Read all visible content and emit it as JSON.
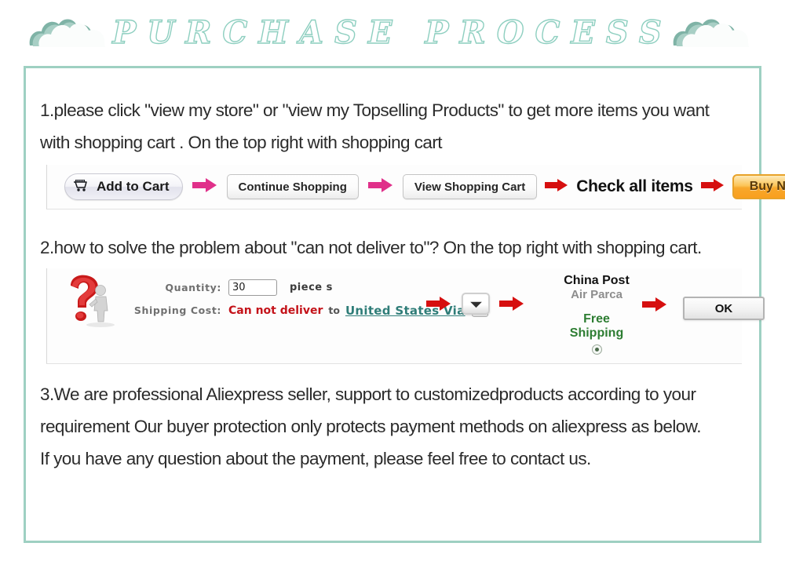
{
  "header": {
    "title": "PURCHASE PROCESS",
    "cloud_icon_left": "cloud-icon",
    "cloud_icon_right": "cloud-icon",
    "accent_color": "#8ecfc0",
    "frame_color": "#9ed0c2"
  },
  "steps": {
    "step1": {
      "line1": "1.please click \"view my store\" or \"view my Topselling Products\" to get more items you want",
      "line2": "with shopping cart . On the top right with shopping cart"
    },
    "step2": {
      "line1": "2.how to solve the problem about \"can not deliver to\"?  On the top right with shopping cart."
    },
    "step3": {
      "line1": "3.We are professional Aliexpress seller, support to customizedproducts according to your",
      "line2": "requirement   Our buyer protection only protects payment methods on aliexpress as below.",
      "line3": "If you have any question   about the payment, please feel free to contact us."
    }
  },
  "flow1": {
    "add_to_cart_label": "Add to Cart",
    "cart_icon": "shopping-cart-icon",
    "arrow1_icon": "arrow-right-pink-icon",
    "continue_shopping_label": "Continue Shopping",
    "arrow2_icon": "arrow-right-pink-icon",
    "view_cart_label": "View Shopping Cart",
    "arrow3_icon": "arrow-right-red-icon",
    "check_all_items_label": "Check all items",
    "arrow4_icon": "arrow-right-red-icon",
    "buy_now_label": "Buy Now",
    "pink_color": "#e0308a",
    "red_color": "#d60f0f",
    "buy_now_color": "#f8a82c"
  },
  "flow2": {
    "question_icon": "question-mark-icon",
    "quantity_label": "Quantity:",
    "quantity_value": "30",
    "quantity_unit": "piece s",
    "shipping_cost_label": "Shipping Cost:",
    "cannot_deliver_text": "Can not deliver",
    "to_text": "to",
    "destination_link": "United States Via",
    "dropdown_small_icon": "chevron-down-icon",
    "arrow1_icon": "arrow-right-red-icon",
    "dropdown_big_icon": "chevron-down-icon",
    "arrow2_icon": "arrow-right-red-icon",
    "carrier_line1": "China Post",
    "carrier_line2": "Air Parca",
    "free_shipping_label": "Free\nShipping",
    "free_shipping_line1": "Free",
    "free_shipping_line2": "Shipping",
    "radio_icon": "radio-selected-icon",
    "arrow3_icon": "arrow-right-red-icon",
    "ok_label": "OK",
    "cannot_color": "#c4131a",
    "link_color": "#2f7d78",
    "free_color": "#2d7d32"
  }
}
